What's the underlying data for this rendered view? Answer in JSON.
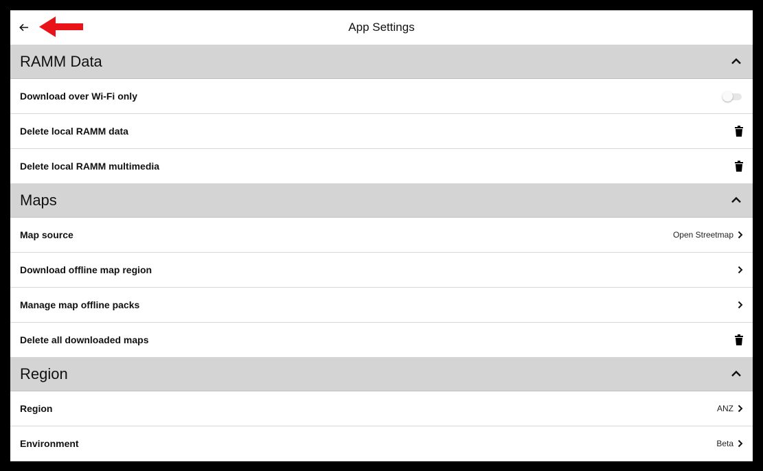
{
  "header": {
    "title": "App Settings",
    "back_icon": "arrow-left-icon",
    "annotation_color": "#e8141a"
  },
  "sections": [
    {
      "title": "RAMM Data",
      "rows": [
        {
          "label": "Download over Wi-Fi only",
          "control": "toggle",
          "toggle_on": false
        },
        {
          "label": "Delete local RAMM data",
          "control": "trash-icon"
        },
        {
          "label": "Delete local RAMM multimedia",
          "control": "trash-icon"
        }
      ]
    },
    {
      "title": "Maps",
      "rows": [
        {
          "label": "Map source",
          "value": "Open Streetmap",
          "control": "chevron-right-icon"
        },
        {
          "label": "Download offline map region",
          "control": "chevron-right-icon"
        },
        {
          "label": "Manage map offline packs",
          "control": "chevron-right-icon"
        },
        {
          "label": "Delete all downloaded maps",
          "control": "trash-icon"
        }
      ]
    },
    {
      "title": "Region",
      "rows": [
        {
          "label": "Region",
          "value": "ANZ",
          "control": "chevron-right-icon"
        },
        {
          "label": "Environment",
          "value": "Beta",
          "control": "chevron-right-icon"
        }
      ]
    }
  ]
}
